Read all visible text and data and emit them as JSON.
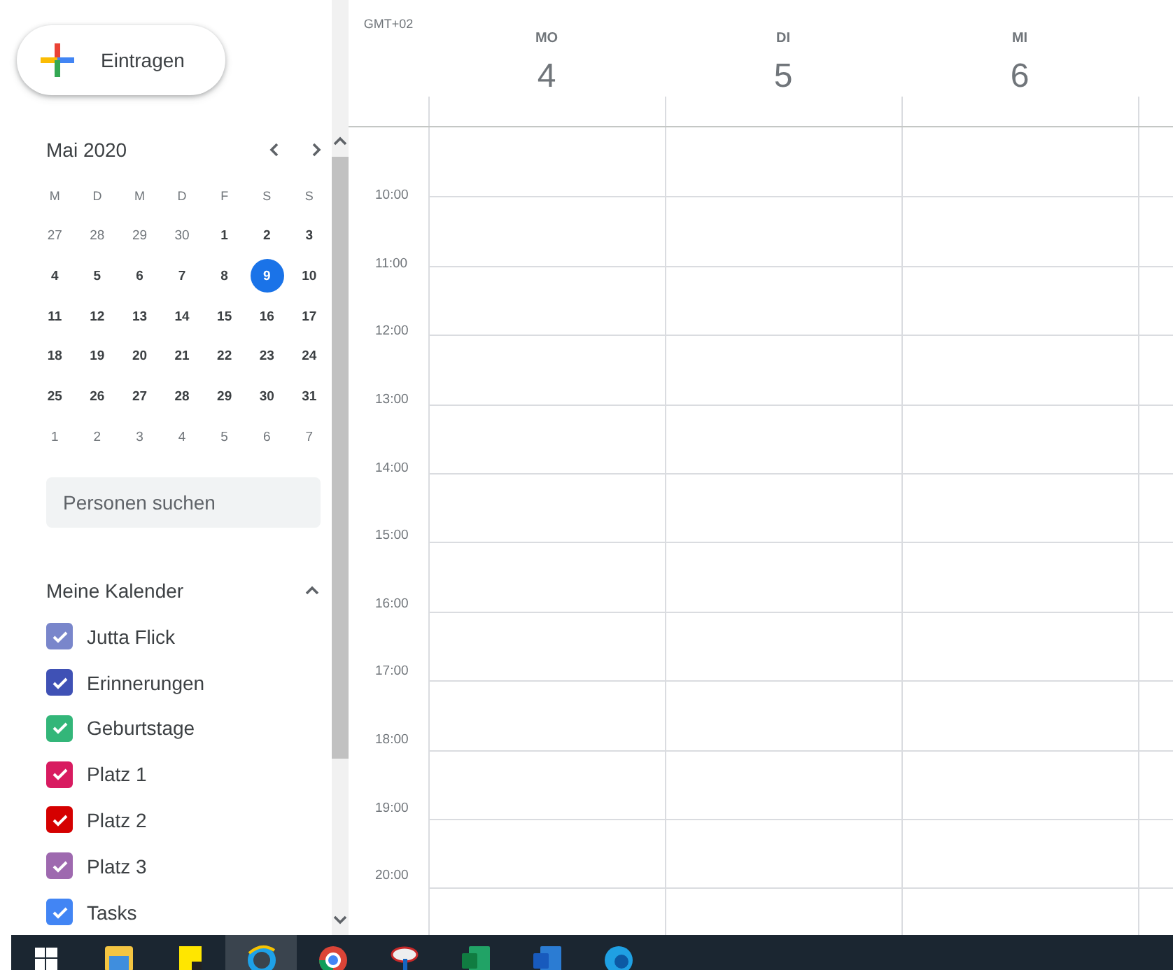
{
  "create_button": {
    "label": "Eintragen"
  },
  "mini_calendar": {
    "month": "Mai 2020",
    "weekdays": [
      "M",
      "D",
      "M",
      "D",
      "F",
      "S",
      "S"
    ],
    "days": [
      {
        "label": "27",
        "muted": true,
        "selected": false
      },
      {
        "label": "28",
        "muted": true,
        "selected": false
      },
      {
        "label": "29",
        "muted": true,
        "selected": false
      },
      {
        "label": "30",
        "muted": true,
        "selected": false
      },
      {
        "label": "1",
        "muted": false,
        "selected": false
      },
      {
        "label": "2",
        "muted": false,
        "selected": false
      },
      {
        "label": "3",
        "muted": false,
        "selected": false
      },
      {
        "label": "4",
        "muted": false,
        "selected": false
      },
      {
        "label": "5",
        "muted": false,
        "selected": false
      },
      {
        "label": "6",
        "muted": false,
        "selected": false
      },
      {
        "label": "7",
        "muted": false,
        "selected": false
      },
      {
        "label": "8",
        "muted": false,
        "selected": false
      },
      {
        "label": "9",
        "muted": false,
        "selected": true
      },
      {
        "label": "10",
        "muted": false,
        "selected": false
      },
      {
        "label": "11",
        "muted": false,
        "selected": false
      },
      {
        "label": "12",
        "muted": false,
        "selected": false
      },
      {
        "label": "13",
        "muted": false,
        "selected": false
      },
      {
        "label": "14",
        "muted": false,
        "selected": false
      },
      {
        "label": "15",
        "muted": false,
        "selected": false
      },
      {
        "label": "16",
        "muted": false,
        "selected": false
      },
      {
        "label": "17",
        "muted": false,
        "selected": false
      },
      {
        "label": "18",
        "muted": false,
        "selected": false
      },
      {
        "label": "19",
        "muted": false,
        "selected": false
      },
      {
        "label": "20",
        "muted": false,
        "selected": false
      },
      {
        "label": "21",
        "muted": false,
        "selected": false
      },
      {
        "label": "22",
        "muted": false,
        "selected": false
      },
      {
        "label": "23",
        "muted": false,
        "selected": false
      },
      {
        "label": "24",
        "muted": false,
        "selected": false
      },
      {
        "label": "25",
        "muted": false,
        "selected": false
      },
      {
        "label": "26",
        "muted": false,
        "selected": false
      },
      {
        "label": "27",
        "muted": false,
        "selected": false
      },
      {
        "label": "28",
        "muted": false,
        "selected": false
      },
      {
        "label": "29",
        "muted": false,
        "selected": false
      },
      {
        "label": "30",
        "muted": false,
        "selected": false
      },
      {
        "label": "31",
        "muted": false,
        "selected": false
      },
      {
        "label": "1",
        "muted": true,
        "selected": false
      },
      {
        "label": "2",
        "muted": true,
        "selected": false
      },
      {
        "label": "3",
        "muted": true,
        "selected": false
      },
      {
        "label": "4",
        "muted": true,
        "selected": false
      },
      {
        "label": "5",
        "muted": true,
        "selected": false
      },
      {
        "label": "6",
        "muted": true,
        "selected": false
      },
      {
        "label": "7",
        "muted": true,
        "selected": false
      }
    ]
  },
  "people_search": {
    "placeholder": "Personen suchen"
  },
  "my_calendars": {
    "title": "Meine Kalender",
    "expanded": true,
    "items": [
      {
        "name": "Jutta Flick",
        "color": "#7986cb",
        "checked": true
      },
      {
        "name": "Erinnerungen",
        "color": "#3f51b5",
        "checked": true
      },
      {
        "name": "Geburtstage",
        "color": "#33b679",
        "checked": true
      },
      {
        "name": "Platz 1",
        "color": "#d81b60",
        "checked": true
      },
      {
        "name": "Platz 2",
        "color": "#d50000",
        "checked": true
      },
      {
        "name": "Platz 3",
        "color": "#9e69af",
        "checked": true
      },
      {
        "name": "Tasks",
        "color": "#4285f4",
        "checked": true
      }
    ]
  },
  "week_view": {
    "timezone": "GMT+02",
    "days": [
      {
        "weekday": "MO",
        "date": "4"
      },
      {
        "weekday": "DI",
        "date": "5"
      },
      {
        "weekday": "MI",
        "date": "6"
      }
    ],
    "hours": [
      "10:00",
      "11:00",
      "12:00",
      "13:00",
      "14:00",
      "15:00",
      "16:00",
      "17:00",
      "18:00",
      "19:00",
      "20:00"
    ]
  },
  "taskbar": {
    "items": [
      {
        "kind": "start",
        "selected": false
      },
      {
        "kind": "folder",
        "selected": false
      },
      {
        "kind": "notes",
        "selected": false
      },
      {
        "kind": "ie",
        "selected": true
      },
      {
        "kind": "chrome",
        "selected": false
      },
      {
        "kind": "satellite",
        "selected": false
      },
      {
        "kind": "excel",
        "selected": false
      },
      {
        "kind": "word",
        "selected": false
      },
      {
        "kind": "edge",
        "selected": false
      }
    ]
  }
}
